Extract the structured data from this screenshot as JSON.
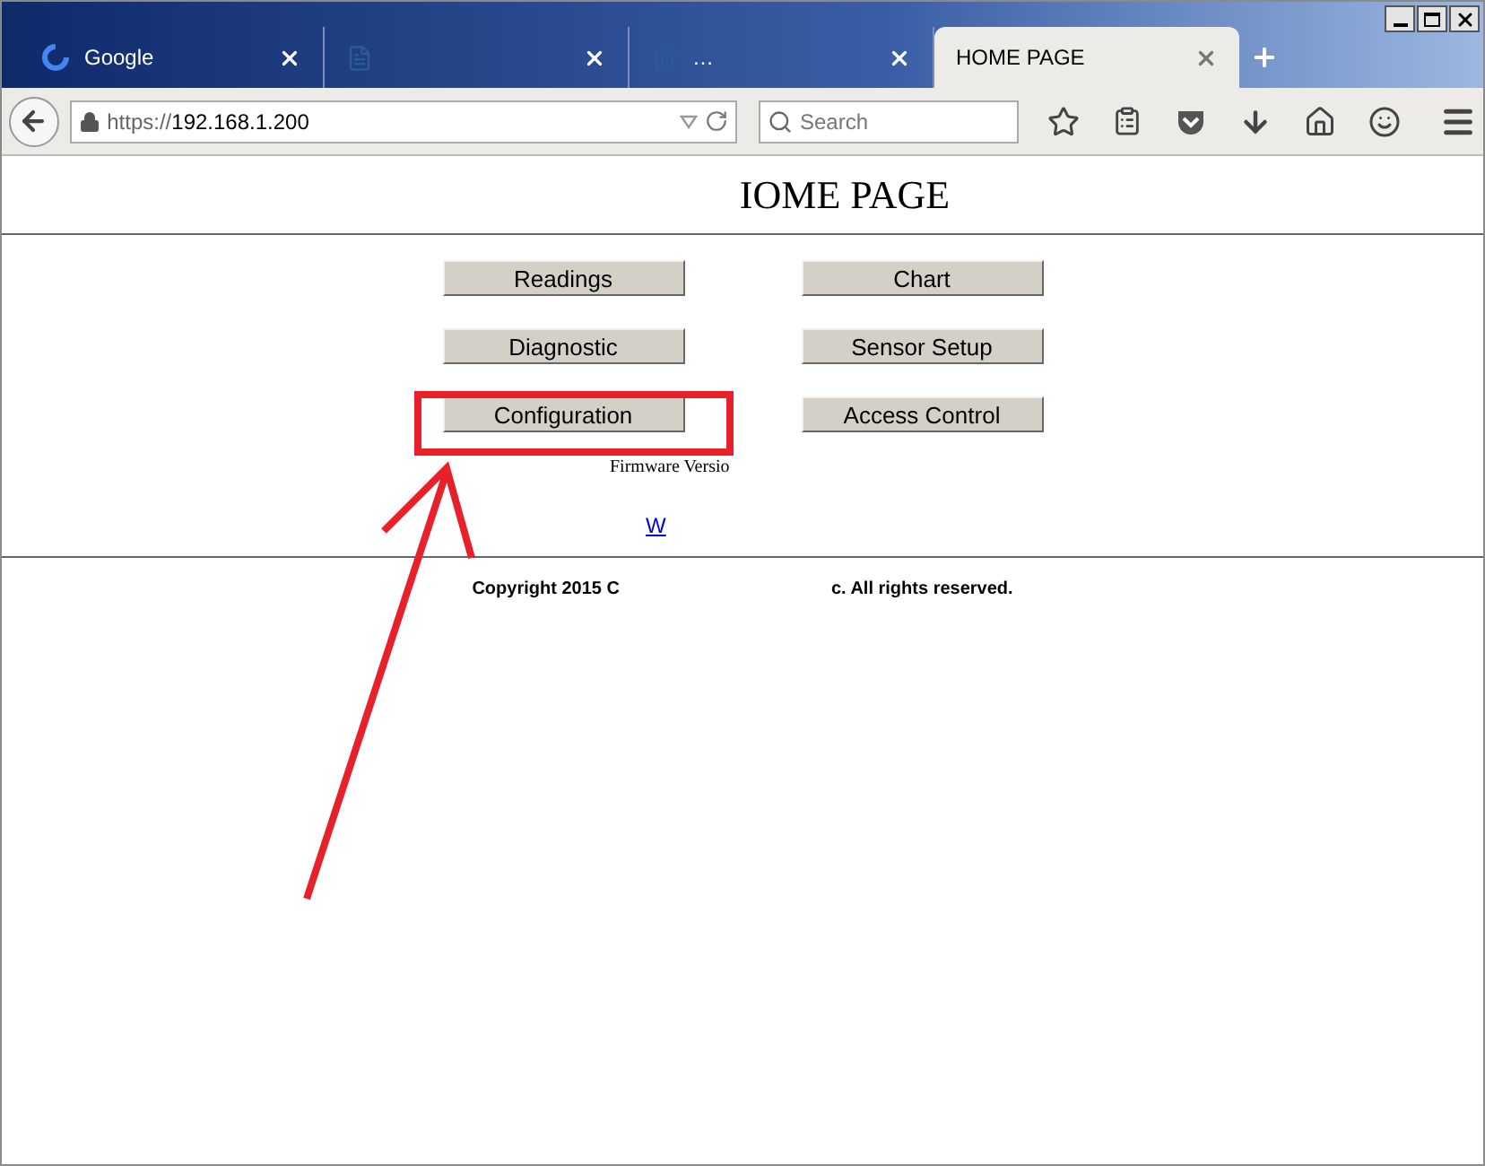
{
  "tabs": [
    {
      "title": "Google",
      "selected": false
    },
    {
      "selected": false
    },
    {
      "title": "…",
      "selected": false
    },
    {
      "title": "HOME PAGE",
      "selected": true
    }
  ],
  "address_bar": {
    "url_scheme": "https://",
    "url_host": "192.168.1.200"
  },
  "search": {
    "placeholder": "Search"
  },
  "page": {
    "heading": "IOME PAGE",
    "buttons": [
      "Readings",
      "Chart",
      "Diagnostic",
      "Sensor Setup",
      "Configuration",
      "Access Control"
    ],
    "firmware": "Firmware Versio",
    "link": "W",
    "copyright_start": "Copyright 2015 C",
    "copyright_end": "c. All rights reserved."
  }
}
